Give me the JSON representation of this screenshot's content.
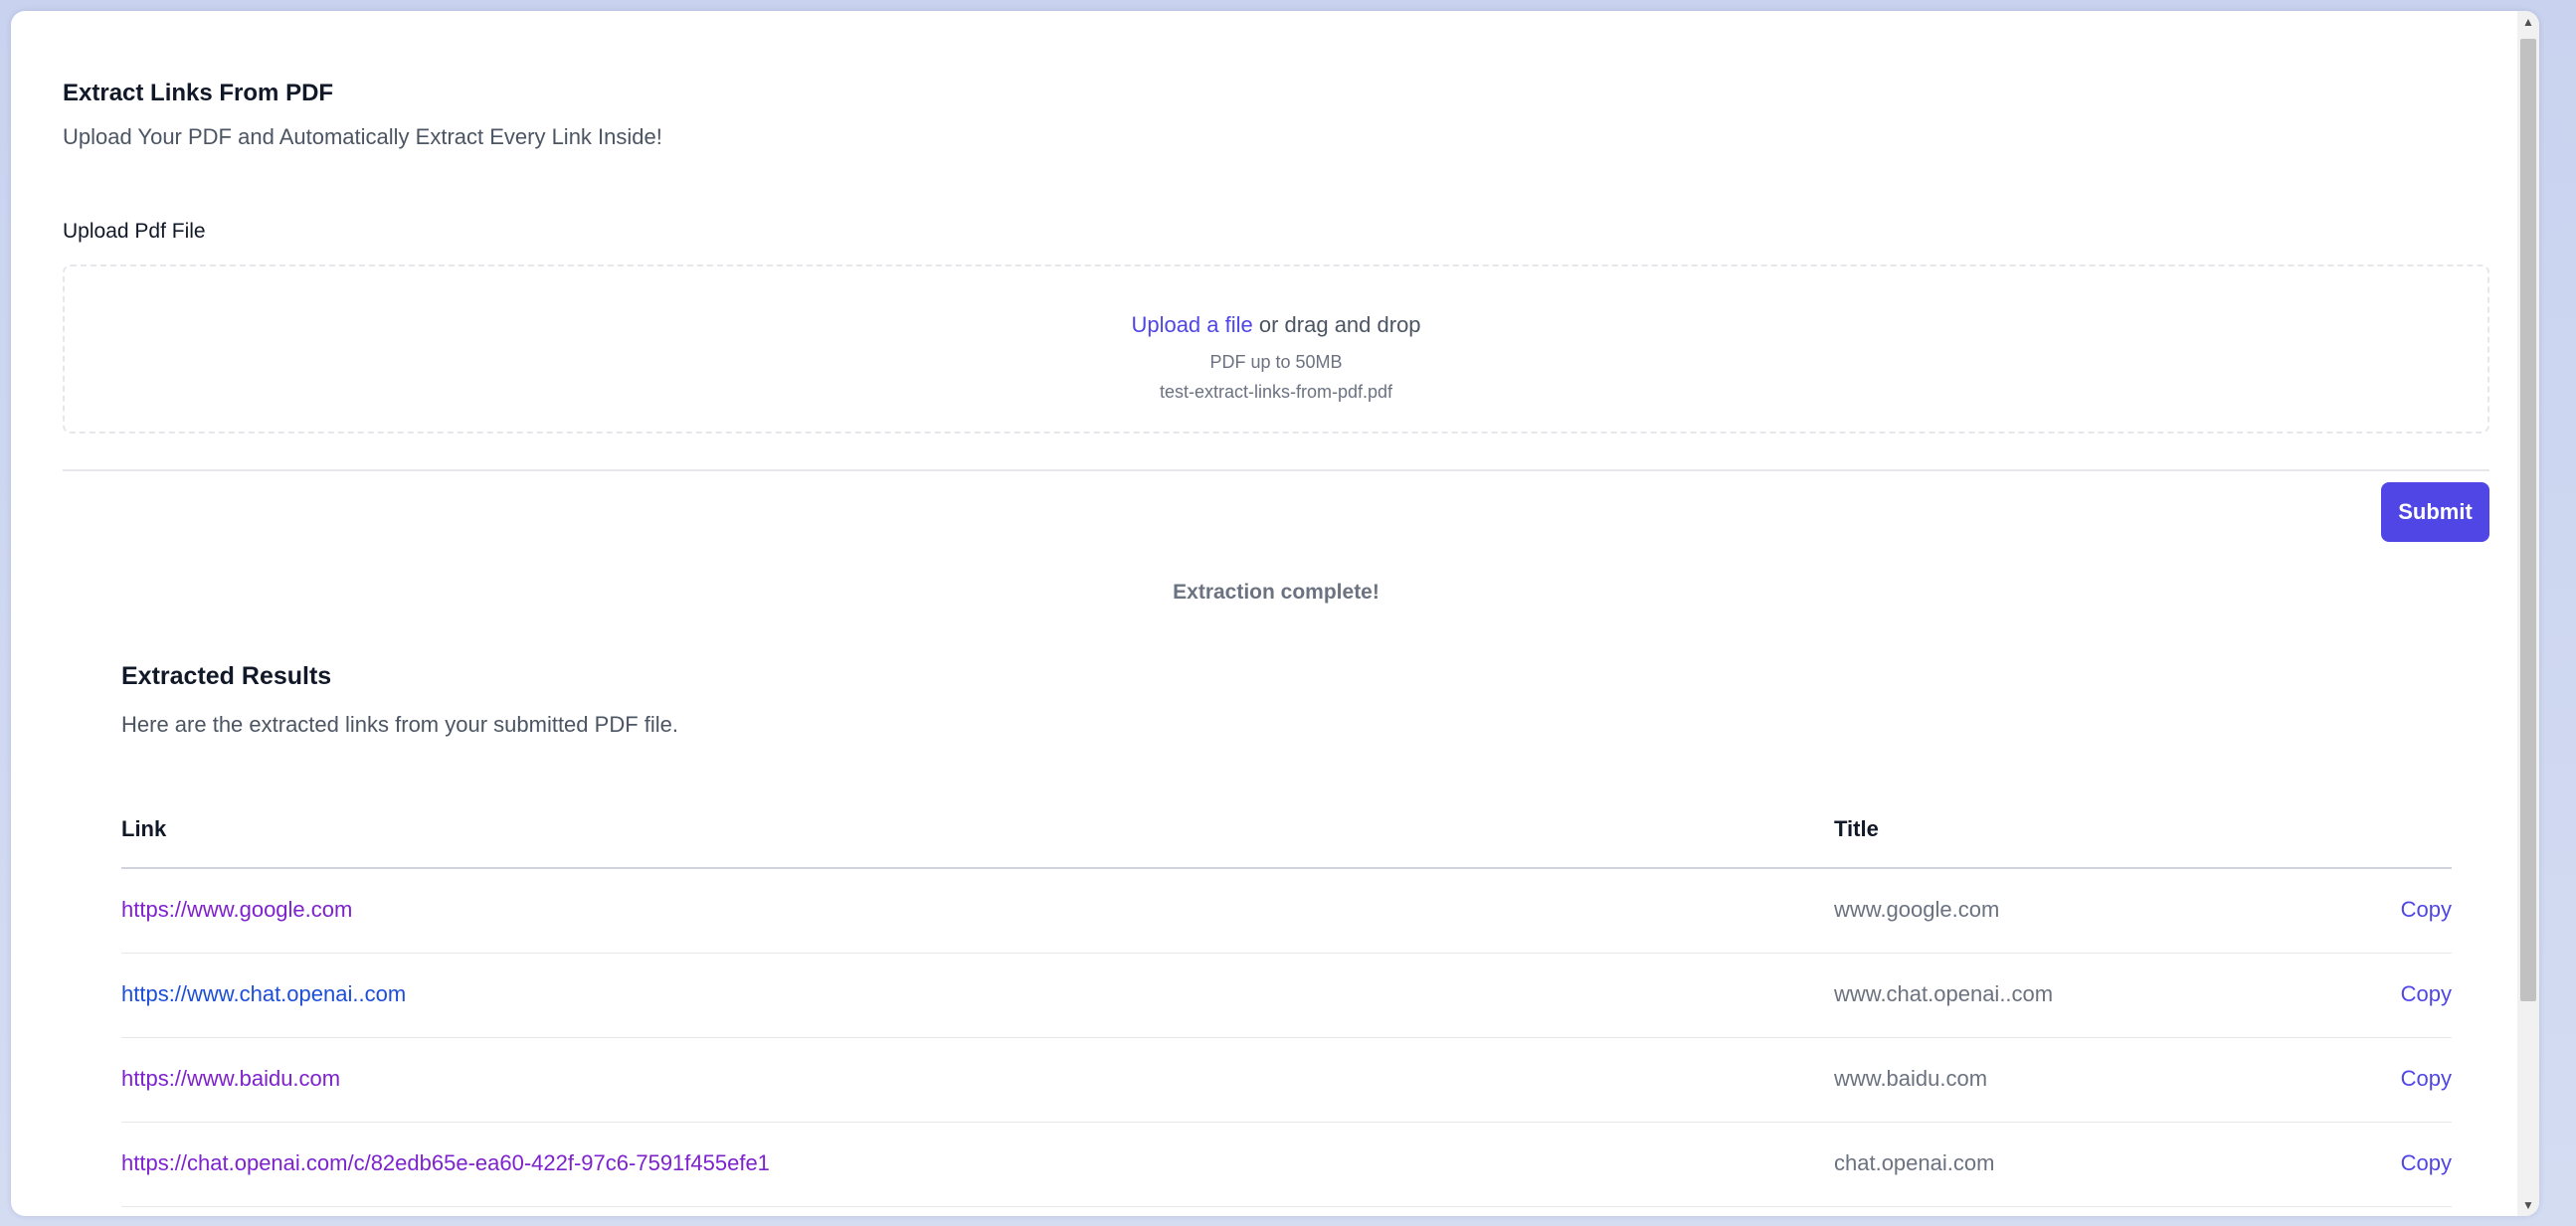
{
  "header": {
    "title": "Extract Links From PDF",
    "subtitle": "Upload Your PDF and Automatically Extract Every Link Inside!"
  },
  "upload": {
    "label": "Upload Pdf File",
    "link_text": "Upload a file",
    "drag_text": " or drag and drop",
    "hint": "PDF up to 50MB",
    "selected_file": "test-extract-links-from-pdf.pdf"
  },
  "actions": {
    "submit_label": "Submit"
  },
  "status": {
    "message": "Extraction complete!"
  },
  "results": {
    "title": "Extracted Results",
    "description": "Here are the extracted links from your submitted PDF file.",
    "columns": {
      "link": "Link",
      "title": "Title"
    },
    "copy_label": "Copy",
    "rows": [
      {
        "link": "https://www.google.com",
        "title": "www.google.com"
      },
      {
        "link": "https://www.chat.openai..com",
        "title": "www.chat.openai..com"
      },
      {
        "link": "https://www.baidu.com",
        "title": "www.baidu.com"
      },
      {
        "link": "https://chat.openai.com/c/82edb65e-ea60-422f-97c6-7591f455efe1",
        "title": "chat.openai.com"
      }
    ]
  },
  "colors": {
    "accent": "#4f46e5",
    "visited_link": "#7e22ce",
    "link": "#1d4ed8"
  }
}
